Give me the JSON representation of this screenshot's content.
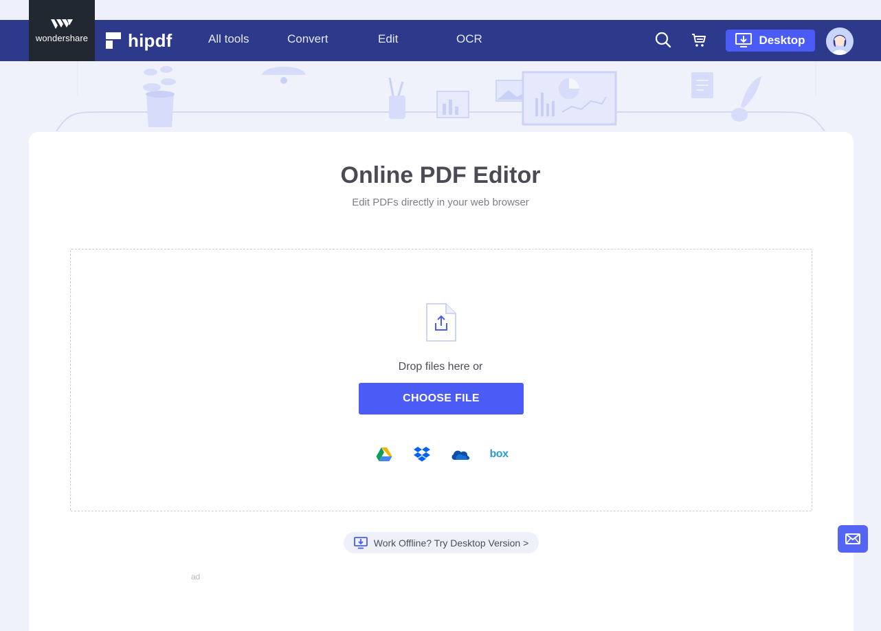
{
  "header": {
    "company_logo_text": "wondershare",
    "brand": "hipdf",
    "nav": [
      {
        "label": "All tools"
      },
      {
        "label": "Convert"
      },
      {
        "label": "Edit"
      },
      {
        "label": "OCR"
      }
    ],
    "desktop_button_label": "Desktop"
  },
  "main": {
    "title": "Online PDF Editor",
    "subtitle": "Edit PDFs directly in your web browser",
    "drop_text": "Drop files here or",
    "choose_button_label": "CHOOSE FILE",
    "cloud_sources": [
      "google-drive-icon",
      "dropbox-icon",
      "onedrive-icon",
      "box-icon"
    ],
    "box_label": "box",
    "offline_link": "Work Offline? Try Desktop Version >",
    "ad_label": "ad"
  },
  "colors": {
    "nav_bg": "#2d3a8c",
    "accent": "#4a5bf6",
    "page_bg": "#eff2fb"
  }
}
